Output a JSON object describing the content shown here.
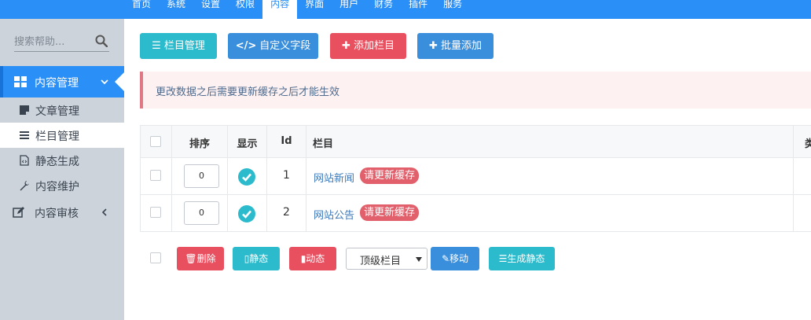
{
  "topnav": [
    "首页",
    "系统",
    "设置",
    "权限",
    "内容",
    "界面",
    "用户",
    "财务",
    "插件",
    "服务"
  ],
  "topnav_active": "内容",
  "sidebar": {
    "search_placeholder": "搜索帮助...",
    "group_active": "内容管理",
    "items": [
      "文章管理",
      "栏目管理",
      "静态生成",
      "内容维护"
    ],
    "active_item": "栏目管理",
    "group2": "内容审核"
  },
  "toolbar": {
    "column_manage": "栏目管理",
    "custom_field": "自定义字段",
    "add_column": "添加栏目",
    "batch_add": "批量添加"
  },
  "alert": "更改数据之后需要更新缓存之后才能生效",
  "table": {
    "headers": {
      "sort": "排序",
      "show": "显示",
      "id": "Id",
      "column": "栏目",
      "extra": "类"
    },
    "rows": [
      {
        "sort": "0",
        "id": "1",
        "name": "网站新闻",
        "badge": "请更新缓存"
      },
      {
        "sort": "0",
        "id": "2",
        "name": "网站公告",
        "badge": "请更新缓存"
      }
    ]
  },
  "actions": {
    "delete": "删除",
    "static": "静态",
    "dynamic": "动态",
    "select_value": "顶级栏目",
    "move": "移动",
    "generate_static": "生成静态"
  },
  "colors": {
    "primary": "#2a8ff7",
    "cyan": "#2bbbcc",
    "blue": "#3a8fdd",
    "red": "#e9505f",
    "check": "#2bbbcc"
  }
}
